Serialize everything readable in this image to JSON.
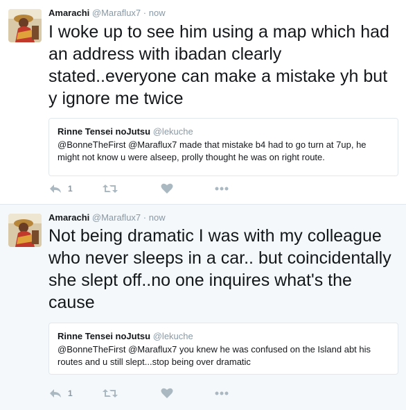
{
  "tweets": [
    {
      "author_name": "Amarachi",
      "author_handle": "@Maraflux7",
      "separator": "·",
      "time": "now",
      "text": "I woke up to see him using a map which had an address with ibadan clearly stated..everyone can make a mistake yh but y ignore me twice",
      "quote": {
        "author_name": "Rinne Tensei noJutsu",
        "author_handle": "@lekuche",
        "text": "@BonneTheFirst @Maraflux7 made that mistake b4 had to go turn at 7up, he might not know u were alseep, prolly thought he was on right route."
      },
      "reply_count": "1"
    },
    {
      "author_name": "Amarachi",
      "author_handle": "@Maraflux7",
      "separator": "·",
      "time": "now",
      "text": "Not being dramatic I was with my colleague who never sleeps in a car.. but coincidentally she slept off..no one inquires what's the cause",
      "quote": {
        "author_name": "Rinne Tensei noJutsu",
        "author_handle": "@lekuche",
        "text": "@BonneTheFirst @Maraflux7 you knew he was confused on the Island abt his routes and u still slept...stop being over dramatic"
      },
      "reply_count": "1"
    }
  ],
  "icons": {
    "reply": "reply-icon",
    "retweet": "retweet-icon",
    "like": "heart-icon",
    "more": "more-icon"
  },
  "colors": {
    "icon": "#aab8c2",
    "muted_text": "#8899a6",
    "highlight_bg": "#f5f8fa"
  }
}
